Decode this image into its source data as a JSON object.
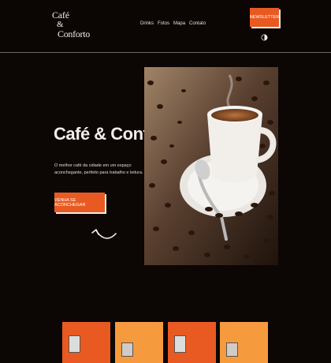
{
  "header": {
    "logo": {
      "line1": "Café",
      "line2": "&",
      "line3": "Conforto"
    },
    "nav": [
      "Drinks",
      "Fotos",
      "Mapa",
      "Contato"
    ],
    "newsletter_label": "NEWSLETTER"
  },
  "hero": {
    "title": "Café & Conforto",
    "description": "O melhor café da cidade em um espaço aconchegante, perfeito para trabalho e leitura.",
    "cta_label": "VENHA SE ACONCHEGAR"
  },
  "colors": {
    "background": "#0c0605",
    "accent": "#e85a22",
    "accent_light": "#f69a3e",
    "text": "#f2ede7"
  },
  "icons": {
    "theme_toggle": "half-moon-icon",
    "arrow": "curved-arrow-icon"
  },
  "cards": [
    {
      "color": "#e85a22",
      "icon": "drink-photo"
    },
    {
      "color": "#f69a3e",
      "icon": "drink-photo"
    },
    {
      "color": "#e85a22",
      "icon": "drink-photo"
    },
    {
      "color": "#f69a3e",
      "icon": "drink-photo"
    }
  ]
}
